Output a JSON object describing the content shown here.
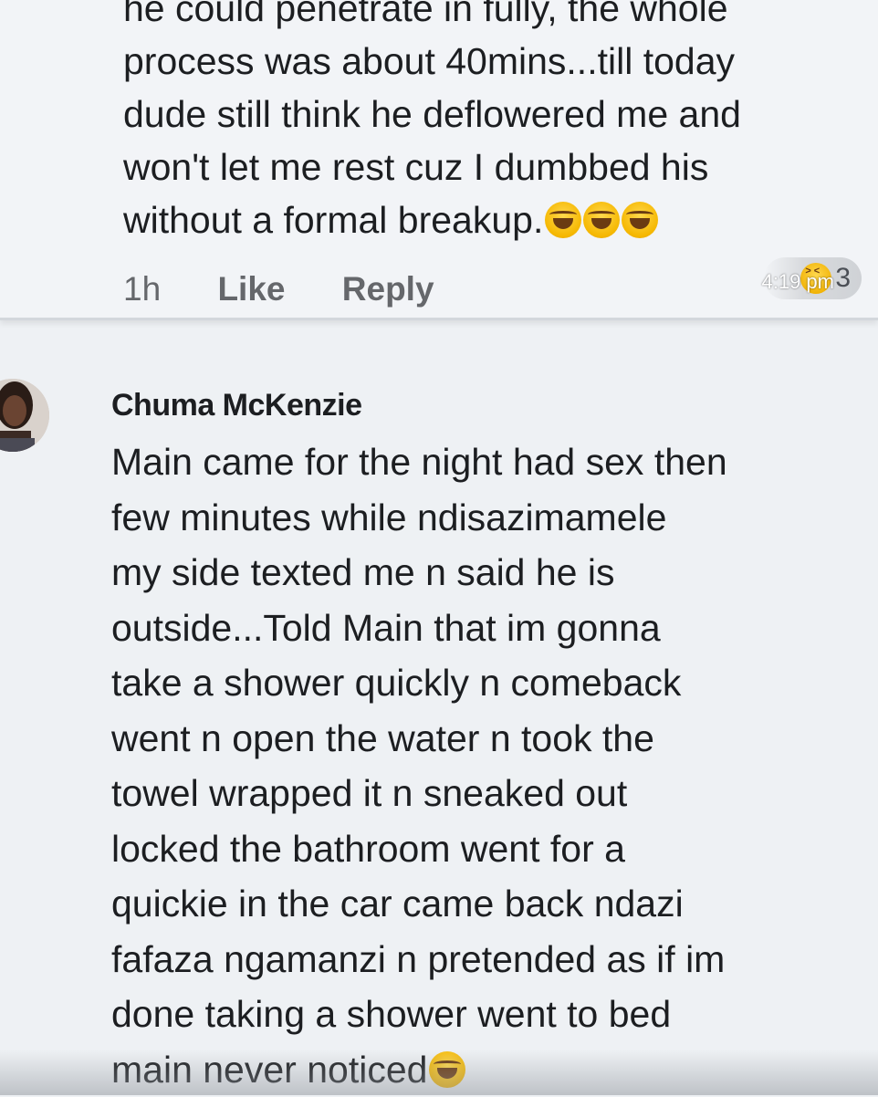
{
  "previous_comment": {
    "text_lines": [
      "he could penetrate in fully, the whole",
      "process was about 40mins...till today",
      "dude still think he deflowered me and",
      "won't let me rest cuz I dumbbed his",
      "without a formal breakup."
    ],
    "emojis": [
      "laughing-tears-emoji",
      "laughing-tears-emoji",
      "laughing-tears-emoji"
    ],
    "time_ago": "1h",
    "like_label": "Like",
    "reply_label": "Reply",
    "reaction_count": "3",
    "timestamp": "4:19 pm"
  },
  "comment": {
    "author": "Chuma McKenzie",
    "text": "Main came for the night had sex then\nfew minutes while ndisazimamele\nmy side texted me n said he is\noutside...Told Main that im gonna\ntake a shower quickly n comeback\nwent n open the water n took the\ntowel wrapped it n sneaked out\nlocked the bathroom went for a\nquickie in the car came back ndazi\nfafaza ngamanzi n pretended as if im\ndone taking a shower went to bed\nmain never noticed",
    "trailing_emoji": "smiling-face-emoji"
  },
  "colors": {
    "background": "#eef1f4",
    "text": "#1c1e21",
    "meta_text": "#65676b"
  }
}
